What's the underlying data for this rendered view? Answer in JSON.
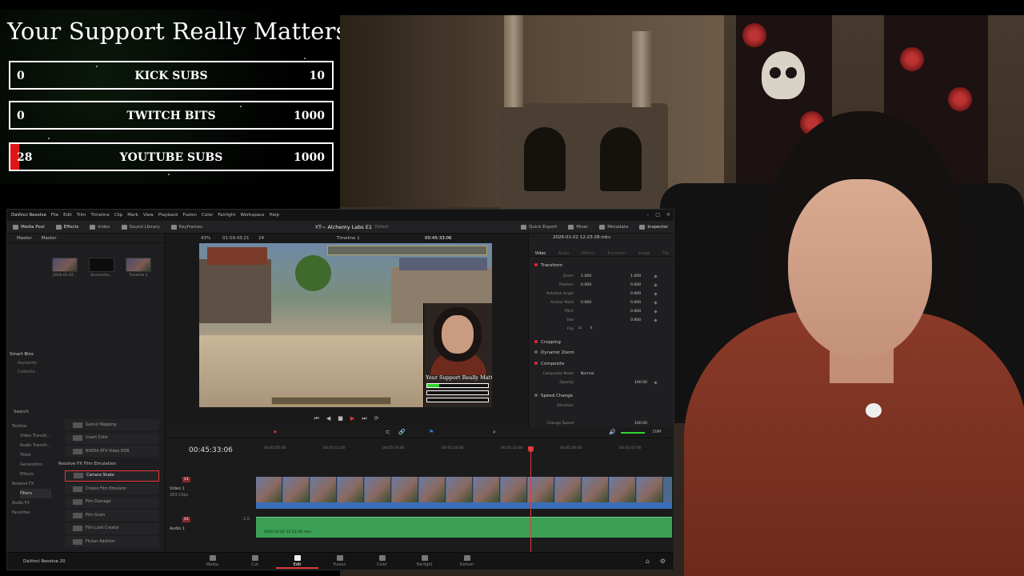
{
  "overlay": {
    "title": "Your Support Really Matters",
    "goals": [
      {
        "start": "0",
        "label": "KICK SUBS",
        "end": "10",
        "progress": 0
      },
      {
        "start": "0",
        "label": "TWITCH BITS",
        "end": "1000",
        "progress": 0
      },
      {
        "start": "28",
        "label": "YOUTUBE SUBS",
        "end": "1000",
        "progress": 0.028
      }
    ],
    "accent": "#e01616"
  },
  "resolve": {
    "app_name": "DaVinci Resolve",
    "menus": [
      "File",
      "Edit",
      "Trim",
      "Timeline",
      "Clip",
      "Mark",
      "View",
      "Playback",
      "Fusion",
      "Color",
      "Fairlight",
      "Workspace",
      "Help"
    ],
    "project_title": "YT~ Alchemy Labs E1",
    "project_status": "Edited",
    "toolbar_left": [
      "Media Pool",
      "Effects",
      "Index",
      "Sound Library",
      "Keyframes"
    ],
    "toolbar_right": [
      "Quick Export",
      "Mixer",
      "Metadata",
      "Inspector"
    ],
    "bin_tabs": [
      "Master",
      "Master"
    ],
    "clips": [
      "2026-01-02...",
      "Screensho...",
      "Timeline 1"
    ],
    "smart_bins": {
      "title": "Smart Bins",
      "items": [
        "Keywords",
        "Collectio..."
      ]
    },
    "viewer": {
      "zoom": "43%",
      "source_tc": "01:59:43:21",
      "fps": "24",
      "timeline_name": "Timeline 1",
      "record_tc": "00:45:33:06"
    },
    "pip": {
      "title": "Your Support Really Matters"
    },
    "inspector": {
      "filename": "2026-01-02 12-23-28.mkv",
      "tabs": [
        "Video",
        "Audio",
        "Effects",
        "Transition",
        "Image",
        "File"
      ],
      "sections": [
        "Transform",
        "Cropping",
        "Dynamic Zoom",
        "Composite",
        "Speed Change"
      ],
      "transform": [
        {
          "label": "Zoom",
          "x": "1.000",
          "y": "1.000"
        },
        {
          "label": "Position",
          "x": "0.000",
          "y": "0.000"
        },
        {
          "label": "Rotation Angle",
          "x": "",
          "y": "0.000"
        },
        {
          "label": "Anchor Point",
          "x": "0.000",
          "y": "0.000"
        },
        {
          "label": "Pitch",
          "x": "",
          "y": "0.000"
        },
        {
          "label": "Yaw",
          "x": "",
          "y": "0.000"
        },
        {
          "label": "Flip",
          "x": "",
          "y": ""
        }
      ],
      "composite_mode_label": "Composite Mode",
      "composite_mode": "Normal",
      "opacity_label": "Opacity",
      "opacity": "100.00",
      "direction_label": "Direction",
      "change_speed_label": "Change Speed",
      "change_speed": "100.00"
    },
    "search": "Search",
    "fx_tree": [
      "Toolbox",
      "Video Transiti...",
      "Audio Transiti...",
      "Titles",
      "Generators",
      "Effects",
      "Resolve FX",
      "Filters",
      "Audio FX",
      "Favorites"
    ],
    "fx_list_top": [
      "Gamut Mapping",
      "Invert Color",
      "NVIDIA RTX Video HDR"
    ],
    "fx_group": "Resolve FX Film Emulation",
    "fx_list": [
      "Camera Shake",
      "Cineon Film Emulator",
      "Film Damage",
      "Film Grain",
      "Film Look Creator",
      "Flicker Addition"
    ],
    "timeline": {
      "timecode": "00:45:33:06",
      "ruler": [
        "00:45:05:00",
        "00:45:12:00",
        "00:45:19:00",
        "00:45:26:00",
        "00:45:33:00",
        "00:45:40:00",
        "00:45:47:00"
      ],
      "video_track": {
        "tag": "V1",
        "name": "Video 1",
        "clips": "283 Clips",
        "clip": "2026-01-02 12-23-28.mkv"
      },
      "audio_track": {
        "tag": "A1",
        "name": "Audio 1",
        "level": "2.0",
        "clip": "2026-01-02 12-23-28.mkv"
      },
      "zoom_label": "DIM"
    },
    "pages": [
      "Media",
      "Cut",
      "Edit",
      "Fusion",
      "Color",
      "Fairlight",
      "Deliver"
    ],
    "active_page": "Edit",
    "brand": "DaVinci Resolve 20"
  }
}
